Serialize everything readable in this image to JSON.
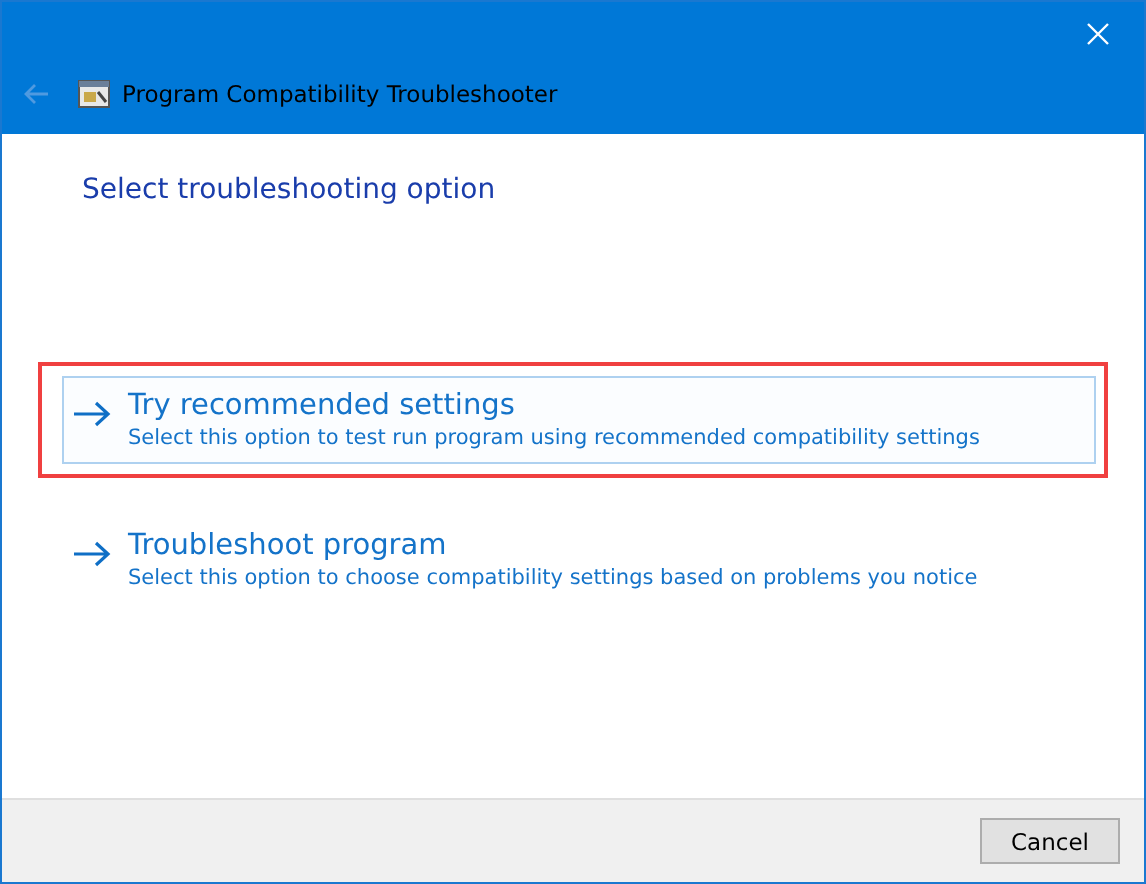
{
  "window": {
    "title": "Program Compatibility Troubleshooter",
    "back_disabled": true
  },
  "heading": "Select troubleshooting option",
  "options": [
    {
      "title": "Try recommended settings",
      "description": "Select this option to test run program using recommended compatibility settings",
      "hovered": true,
      "highlighted": true
    },
    {
      "title": "Troubleshoot program",
      "description": "Select this option to choose compatibility settings based on problems you notice",
      "hovered": false,
      "highlighted": false
    }
  ],
  "buttons": [
    "Cancel"
  ]
}
